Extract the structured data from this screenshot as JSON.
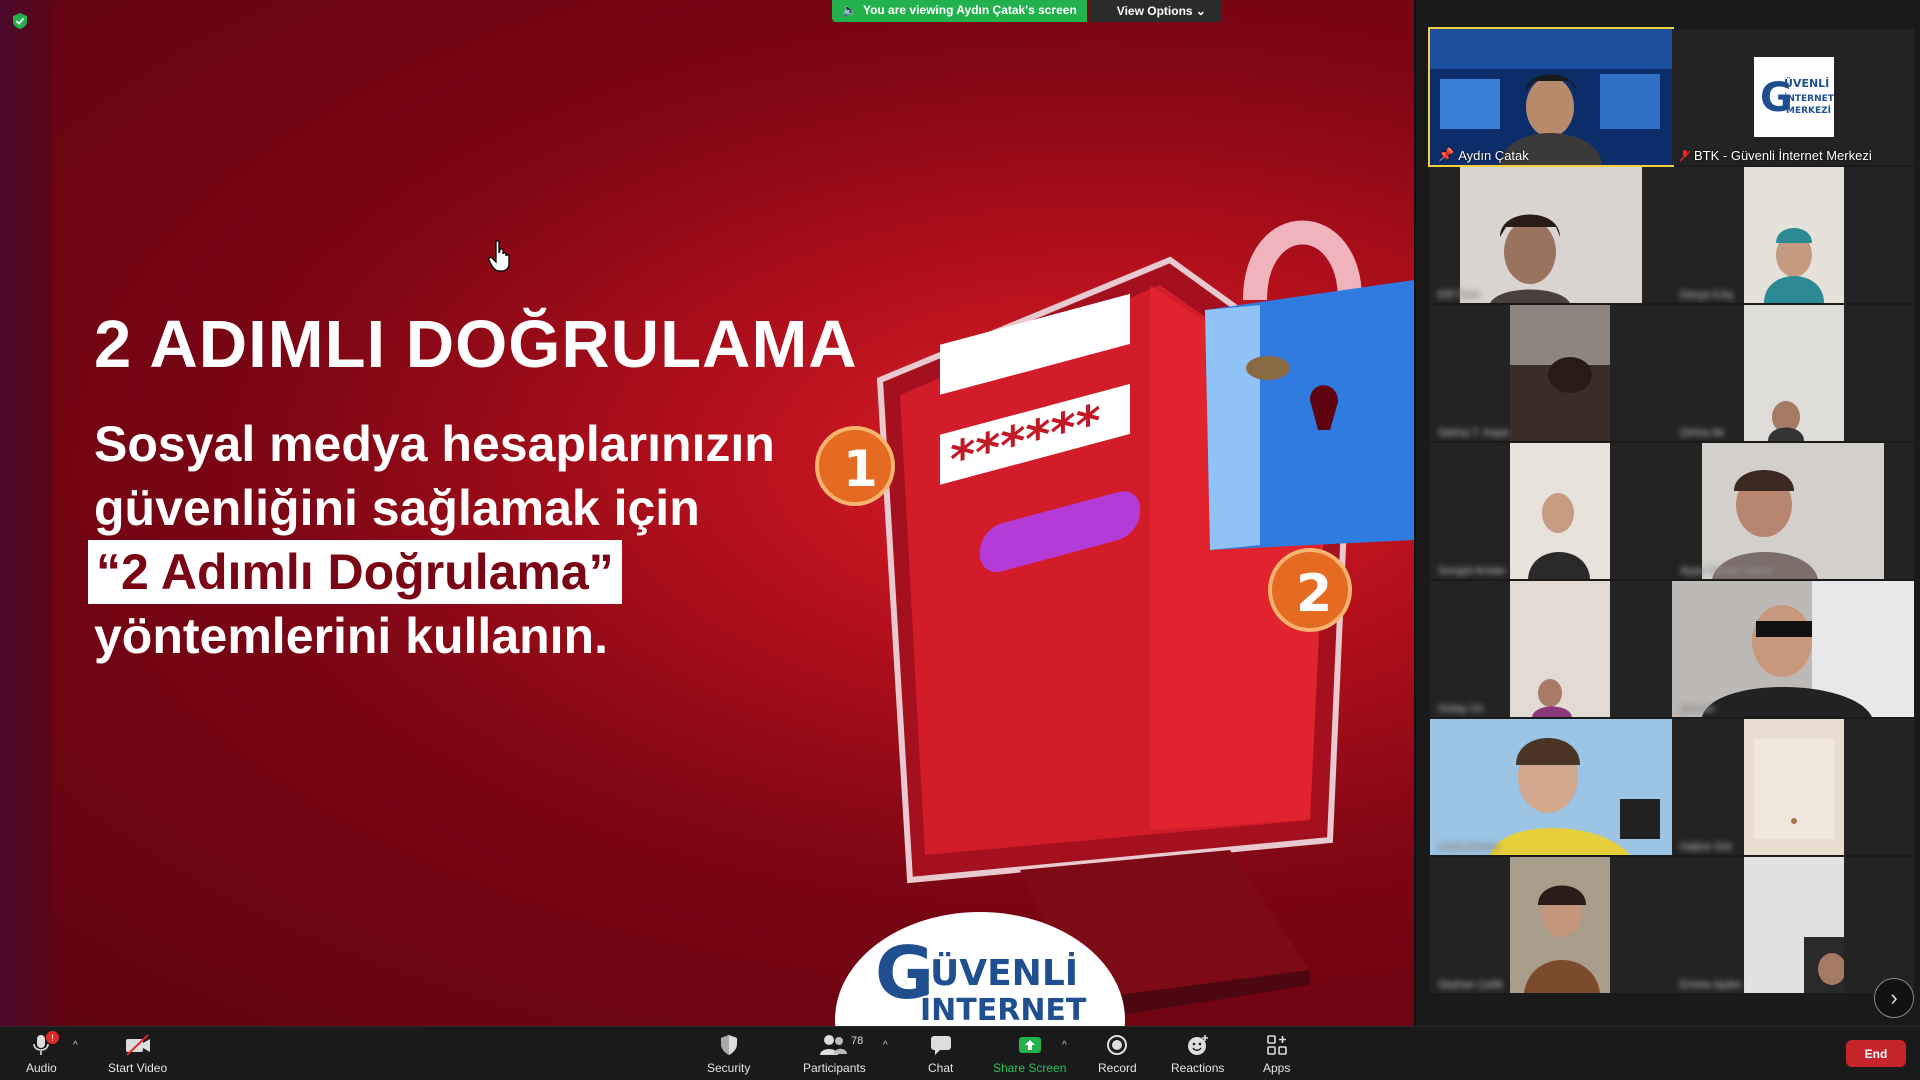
{
  "banner": {
    "viewing": "You are viewing Aydın Çatak's screen",
    "view_options": "View Options"
  },
  "slide": {
    "title": "2 ADIMLI DOĞRULAMA",
    "line1": "Sosyal medya hesaplarınızın",
    "line2": "güvenliğini sağlamak için",
    "highlight": "“2 Adımlı Doğrulama”",
    "line4": "yöntemlerini kullanın.",
    "badge1": "1",
    "badge2": "2",
    "password_mask": "******",
    "logo_text1": "ÜVENLİ",
    "logo_text2": "İNTERNET"
  },
  "gallery": {
    "host_name": "Aydın Çatak",
    "btk_name": "BTK - Güvenli İnternet Merkezi",
    "btk_logo_line1": "ÜVENLİ",
    "btk_logo_line2": "İNTERNET",
    "btk_logo_line3": "MERKEZİ",
    "participants": [
      {
        "name": "Elif Özer"
      },
      {
        "name": "Derya Kılıç"
      },
      {
        "name": "Selma T. Kaya"
      },
      {
        "name": "Zehra Ak"
      },
      {
        "name": "Songül Arslan"
      },
      {
        "name": "Ayşe Yılmaz Demir"
      },
      {
        "name": "Gülay Ün"
      },
      {
        "name": "Şükran"
      },
      {
        "name": "Leyla Erdem"
      },
      {
        "name": "Hatice Gül"
      },
      {
        "name": "Seyhan Çelik"
      },
      {
        "name": "Emine Aydın"
      }
    ]
  },
  "toolbar": {
    "audio": "Audio",
    "audio_badge": "!",
    "video": "Start Video",
    "security": "Security",
    "participants": "Participants",
    "participants_count": "78",
    "chat": "Chat",
    "share": "Share Screen",
    "record": "Record",
    "reactions": "Reactions",
    "apps": "Apps",
    "end": "End"
  },
  "colors": {
    "share_green": "#22b14c",
    "end_red": "#c7252c",
    "active_outline": "#f2d13d",
    "slide_red": "#7a0514"
  }
}
